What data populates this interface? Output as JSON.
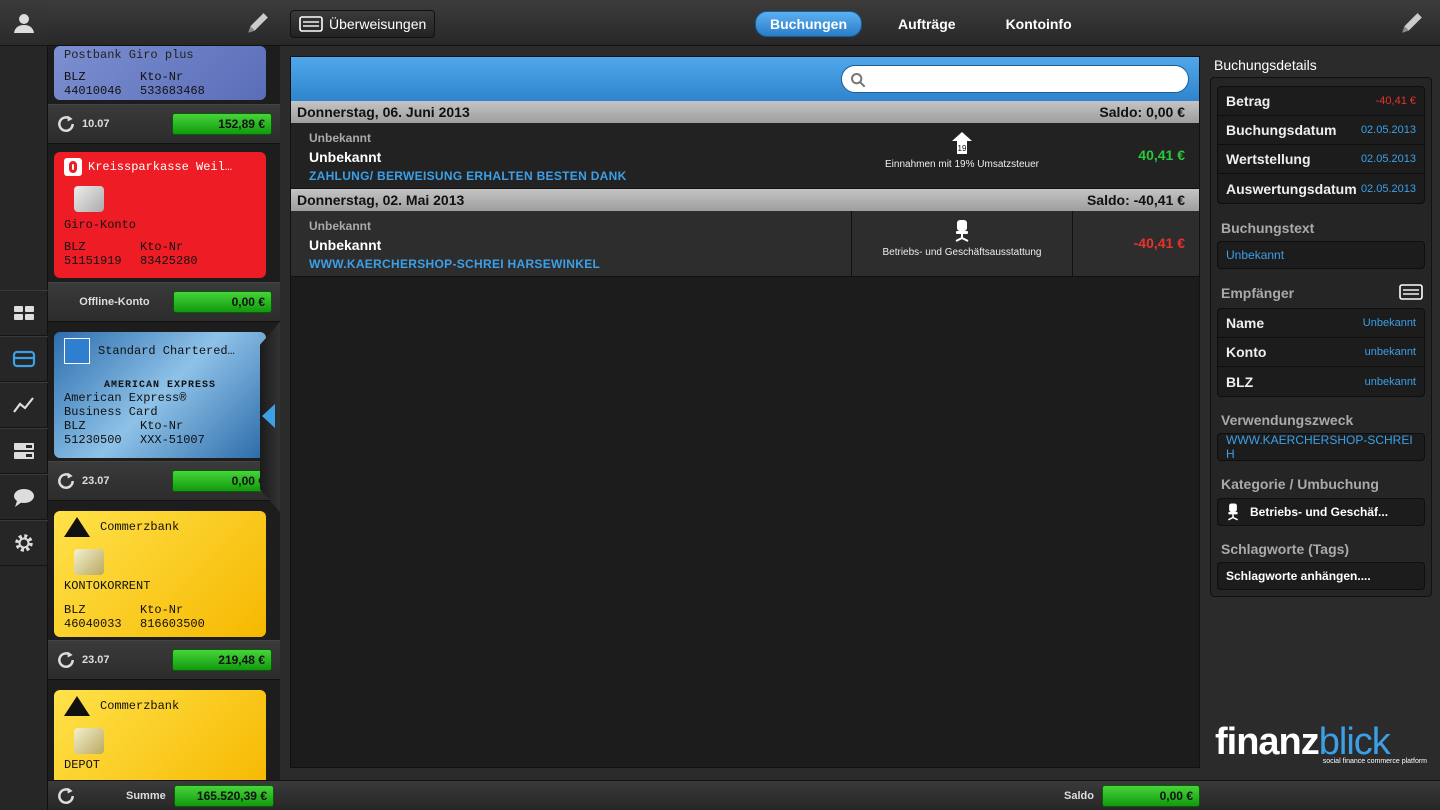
{
  "top": {
    "transfer_button": "Überweisungen",
    "tabs": [
      {
        "label": "Buchungen",
        "active": true
      },
      {
        "label": "Aufträge",
        "active": false
      },
      {
        "label": "Kontoinfo",
        "active": false
      }
    ]
  },
  "accounts": [
    {
      "card_name": "Postbank Giro plus",
      "blz_label": "BLZ",
      "kto_label": "Kto-Nr",
      "blz": "44010046",
      "kto": "533683468",
      "sync": "10.07",
      "balance": "152,89 €"
    },
    {
      "card_name": "Kreissparkasse Weil…",
      "account_type": "Giro-Konto",
      "blz_label": "BLZ",
      "kto_label": "Kto-Nr",
      "blz": "51151919",
      "kto": "83425280",
      "status": "Offline-Konto",
      "balance": "0,00 €"
    },
    {
      "card_name": "Standard Chartered…",
      "line1": "American Express®",
      "line2": "Business Card",
      "brand": "AMERICAN EXPRESS",
      "blz_label": "BLZ",
      "kto_label": "Kto-Nr",
      "blz": "51230500",
      "kto": "XXX-51007",
      "sync": "23.07",
      "balance": "0,00 €"
    },
    {
      "card_name": "Commerzbank",
      "account_type": "KONTOKORRENT",
      "blz_label": "BLZ",
      "kto_label": "Kto-Nr",
      "blz": "46040033",
      "kto": "816603500",
      "sync": "23.07",
      "balance": "219,48 €"
    },
    {
      "card_name": "Commerzbank",
      "account_type": "DEPOT"
    }
  ],
  "footer": {
    "sum_label": "Summe",
    "sum_value": "165.520,39 €",
    "saldo_label": "Saldo",
    "saldo_value": "0,00 €"
  },
  "search": {
    "placeholder": ""
  },
  "days": [
    {
      "date": "Donnerstag, 06. Juni 2013",
      "saldo": "Saldo: 0,00 €",
      "tx": {
        "category_top": "Unbekannt",
        "name": "Unbekannt",
        "purpose": "ZAHLUNG/ BERWEISUNG ERHALTEN BESTEN DANK",
        "category": "Einnahmen mit 19% Umsatzsteuer",
        "icon_badge": "19",
        "amount": "40,41 €"
      }
    },
    {
      "date": "Donnerstag, 02. Mai 2013",
      "saldo": "Saldo: -40,41 €",
      "tx": {
        "category_top": "Unbekannt",
        "name": "Unbekannt",
        "purpose": "WWW.KAERCHERSHOP-SCHREI HARSEWINKEL",
        "category": "Betriebs- und Geschäftsausstattung",
        "amount": "-40,41 €"
      }
    }
  ],
  "details": {
    "title": "Buchungsdetails",
    "rows": [
      {
        "k": "Betrag",
        "v": "-40,41 €"
      },
      {
        "k": "Buchungsdatum",
        "v": "02.05.2013"
      },
      {
        "k": "Wertstellung",
        "v": "02.05.2013"
      },
      {
        "k": "Auswertungsdatum",
        "v": "02.05.2013"
      }
    ],
    "buchungstext_label": "Buchungstext",
    "buchungstext": "Unbekannt",
    "empfaenger_label": "Empfänger",
    "empfaenger": [
      {
        "k": "Name",
        "v": "Unbekannt"
      },
      {
        "k": "Konto",
        "v": "unbekannt"
      },
      {
        "k": "BLZ",
        "v": "unbekannt"
      }
    ],
    "verwendung_label": "Verwendungszweck",
    "verwendung": "WWW.KAERCHERSHOP-SCHREI H",
    "kategorie_label": "Kategorie / Umbuchung",
    "kategorie": "Betriebs- und Geschäf...",
    "tags_label": "Schlagworte (Tags)",
    "tags": "Schlagworte anhängen...."
  },
  "logo": {
    "word_a": "finanz",
    "word_b": "blick",
    "tagline": "social finance commerce platform"
  },
  "colors": {
    "accent": "#3ca0e8",
    "positive": "#28c83a",
    "negative": "#e8322c"
  }
}
